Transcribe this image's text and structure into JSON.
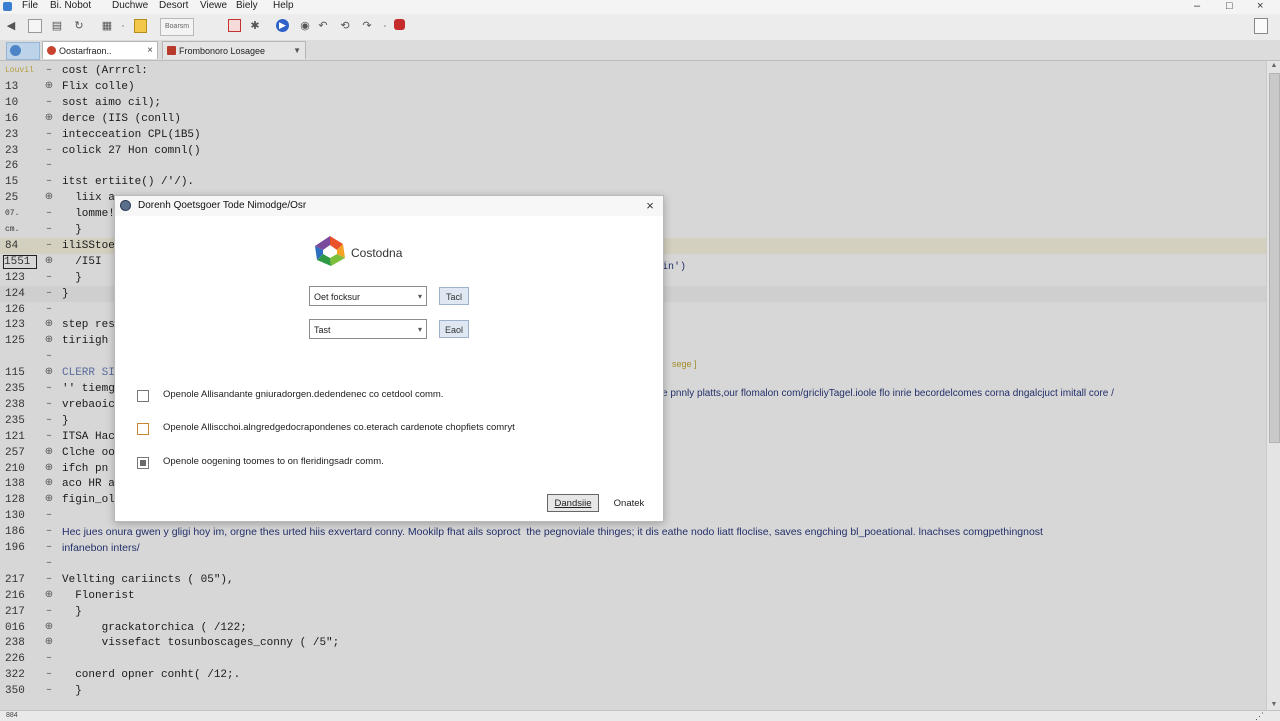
{
  "menu": {
    "items": [
      "File",
      "Bi. Nobot",
      "Duchwe",
      "Desort",
      "Viewe",
      "Biely",
      "Help"
    ],
    "window_controls": [
      "–",
      "□",
      "×"
    ]
  },
  "toolbar": {
    "group_label": "Boarsm"
  },
  "tabs": [
    {
      "label": "Oostarfraon..",
      "close": "×"
    },
    {
      "label": "Frombonoro Losagee",
      "dropdown": "▼"
    }
  ],
  "editor": {
    "lines": [
      {
        "ln": "Louvil",
        "code": "cost (Arrrcl:"
      },
      {
        "ln": "13",
        "code": "Flix colle)"
      },
      {
        "ln": "10",
        "code": "sost aimo cil);"
      },
      {
        "ln": "16",
        "code": "derce (IIS (conll)"
      },
      {
        "ln": "23",
        "code": "intecceation CPL(1B5)"
      },
      {
        "ln": "23",
        "code": "colick 27 Hon comnl()"
      },
      {
        "ln": "26",
        "code": ""
      },
      {
        "ln": "15",
        "code": "itst ertiite() /'/)."
      },
      {
        "ln": "25",
        "code": "  liix a"
      },
      {
        "ln": "07.",
        "code": "  lomme!"
      },
      {
        "ln": "cm.",
        "code": "  }"
      },
      {
        "ln": "84",
        "code": "iliSStoe"
      },
      {
        "ln": "1551",
        "code": "  /I5I"
      },
      {
        "ln": "123",
        "code": "  }"
      },
      {
        "ln": "124",
        "code": "}"
      },
      {
        "ln": "126",
        "code": ""
      },
      {
        "ln": "123",
        "code": "step res"
      },
      {
        "ln": "125",
        "code": "tiriigh ["
      },
      {
        "ln": "",
        "code": ""
      },
      {
        "ln": "115",
        "code": "CLERR SIR"
      },
      {
        "ln": "235",
        "code": "'' tiemgc"
      },
      {
        "ln": "238",
        "code": "vrebaoic"
      },
      {
        "ln": "235",
        "code": "}"
      },
      {
        "ln": "121",
        "code": "ITSA Hacl"
      },
      {
        "ln": "257",
        "code": "Clche oo"
      },
      {
        "ln": "210",
        "code": "ifch pn"
      },
      {
        "ln": "138",
        "code": "aco HR a"
      },
      {
        "ln": "128",
        "code": "figin_ol"
      },
      {
        "ln": "130",
        "code": ""
      },
      {
        "ln": "186",
        "code": "Hec jues onura gwen y gligi hoy im, orgne thes urted hiis exvertard conny. Mookilp fhat ails soproct  the pegnoviale thinges; it dis eathe nodo liatt floclise, saves engching bl_poeational. lnachses comgpethingnost"
      },
      {
        "ln": "196",
        "code": "infanebon inters/"
      },
      {
        "ln": "",
        "code": ""
      },
      {
        "ln": "217",
        "code": "Vellting cariincts ( 05\"),"
      },
      {
        "ln": "216",
        "code": "  Flonerist"
      },
      {
        "ln": "217",
        "code": "  }"
      },
      {
        "ln": "016",
        "code": "      grackatorchica ( /122;"
      },
      {
        "ln": "238",
        "code": "      vissefact tosunboscages_conny ( /5\";"
      },
      {
        "ln": "226",
        "code": ""
      },
      {
        "ln": "322",
        "code": "  conerd opner conht( /12;."
      },
      {
        "ln": "350",
        "code": "  }"
      }
    ],
    "overflow_right": {
      "line_12": "in')",
      "line_18": "sege ]",
      "line_21": "e pnnly platts,our flomalon com/gricliyTagel.ioole flo inrie becordelcomes corna dngalcjuct imitall core /"
    }
  },
  "dialog": {
    "title": "Dorenh Qoetsgoer Tode Nimodge/Osr",
    "close": "×",
    "logo_text": "Costodna",
    "combo1": {
      "value": "Oet focksur",
      "arrow": "▾"
    },
    "combo2": {
      "value": "Tast",
      "arrow": "▾"
    },
    "button1": "Tacl",
    "button2": "Eaol",
    "options": [
      "Openole Allisandante gniuradorgen.dedendenec co cetdool comm.",
      "Openole Alliscchoi.alngredgedocrapondenes co.eterach cardenote chopfiets comryt",
      "Openole oogening toomes to on fleridingsadr comm."
    ],
    "primary_button": "Dandsiie",
    "secondary_button": "Onatek"
  },
  "statusbar": {
    "left": "884"
  },
  "colors": {
    "editor_bg": "#d7d7d7",
    "prose_text": "#23306a",
    "dialog_bg": "#ffffff",
    "accent": "#2f62c8"
  }
}
